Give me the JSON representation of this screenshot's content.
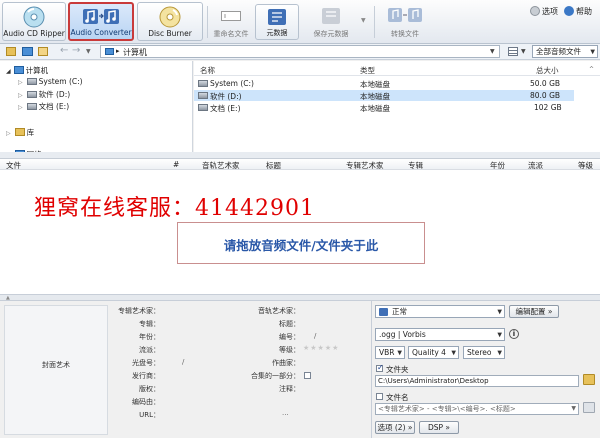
{
  "toolbar": {
    "audio_cd_ripper": "Audio CD Ripper",
    "audio_converter": "Audio Converter",
    "disc_burner": "Disc Burner",
    "rename_files": "重命名文件",
    "metadata": "元数据",
    "save_metadata": "保存元数据",
    "convert_files": "转换文件",
    "options": "选项",
    "help": "帮助"
  },
  "address": {
    "path": "计算机",
    "filter": "全部音频文件"
  },
  "tree": {
    "computer": "计算机",
    "drives": [
      "System (C:)",
      "软件 (D:)",
      "文档 (E:)"
    ],
    "library": "库",
    "network": "网络"
  },
  "files": {
    "headers": [
      "名称",
      "类型",
      "总大小"
    ],
    "rows": [
      {
        "name": "System (C:)",
        "type": "本地磁盘",
        "size": "50.0 GB"
      },
      {
        "name": "软件 (D:)",
        "type": "本地磁盘",
        "size": "80.0 GB"
      },
      {
        "name": "文档 (E:)",
        "type": "本地磁盘",
        "size": "102 GB"
      }
    ]
  },
  "tracks": {
    "headers": [
      "文件",
      "#",
      "音轨艺术家",
      "标题",
      "专辑艺术家",
      "专辑",
      "年份",
      "流派",
      "等级"
    ],
    "watermark": "狸窝在线客服：41442901",
    "drop_hint": "请拖放音频文件/文件夹于此"
  },
  "meta": {
    "cover_art": "封面艺术",
    "left_labels": [
      "专辑艺术家：",
      "专辑：",
      "年份：",
      "流派：",
      "光盘号：",
      "发行商：",
      "版权：",
      "编码由：",
      "URL："
    ],
    "right_labels": [
      "音轨艺术家：",
      "标题：",
      "编号：",
      "等级：",
      "作曲家：",
      "合集的一部分：",
      "注释："
    ],
    "disc_slash": "/",
    "track_slash": "/",
    "url_dots": "..."
  },
  "encoder": {
    "quality_preset": "正常",
    "edit_config": "编辑配置 »",
    "format": ".ogg | Vorbis",
    "mode": "VBR",
    "quality": "Quality 4",
    "channels": "Stereo",
    "folder_label": "文件夹",
    "folder_path": "C:\\Users\\Administrator\\Desktop",
    "filename_label": "文件名",
    "filename_pattern": "<专辑艺术家> - <专辑>\\<编号>. <标题>",
    "options_button": "选项 (2) »",
    "dsp_button": "DSP »"
  }
}
